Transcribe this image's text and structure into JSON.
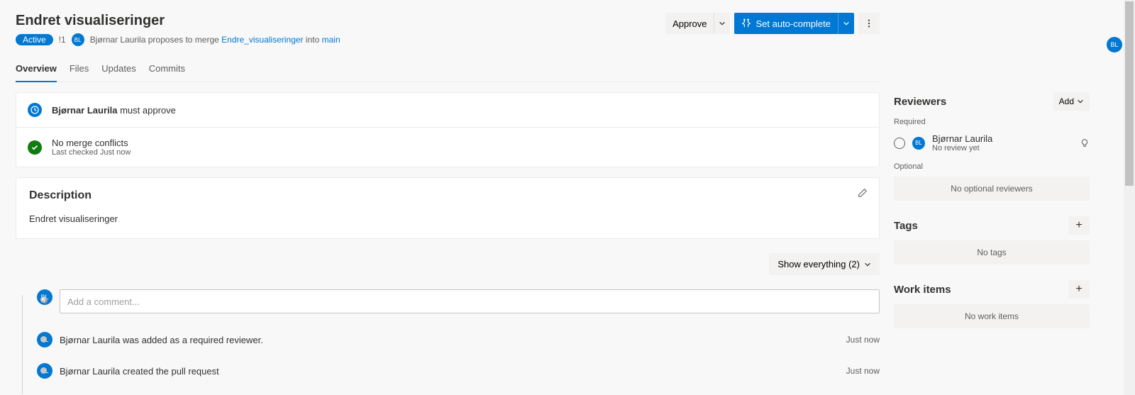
{
  "header": {
    "title": "Endret visualiseringer",
    "status_badge": "Active",
    "pr_id": "!1",
    "avatar_initials": "BL",
    "author_name": "Bjørnar Laurila",
    "proposes_text": "proposes to merge",
    "source_branch": "Endre_visualiseringer",
    "into_text": "into",
    "target_branch": "main",
    "approve_label": "Approve",
    "autocomplete_label": "Set auto-complete"
  },
  "tabs": {
    "overview": "Overview",
    "files": "Files",
    "updates": "Updates",
    "commits": "Commits"
  },
  "status": {
    "approval_name": "Bjørnar Laurila",
    "approval_rest": "must approve",
    "merge_title": "No merge conflicts",
    "merge_sub": "Last checked Just now"
  },
  "description": {
    "heading": "Description",
    "body": "Endret visualiseringer"
  },
  "filter": {
    "label": "Show everything (2)"
  },
  "comment": {
    "placeholder": "Add a comment..."
  },
  "activity": [
    {
      "avatar": "BL",
      "text": "Bjørnar Laurila was added as a required reviewer.",
      "time": "Just now"
    },
    {
      "avatar": "BL",
      "text": "Bjørnar Laurila created the pull request",
      "time": "Just now"
    }
  ],
  "side": {
    "reviewers": {
      "heading": "Reviewers",
      "add_label": "Add",
      "required_label": "Required",
      "optional_label": "Optional",
      "reviewer_name": "Bjørnar Laurila",
      "reviewer_status": "No review yet",
      "no_optional": "No optional reviewers"
    },
    "tags": {
      "heading": "Tags",
      "empty": "No tags"
    },
    "workitems": {
      "heading": "Work items",
      "empty": "No work items"
    }
  }
}
